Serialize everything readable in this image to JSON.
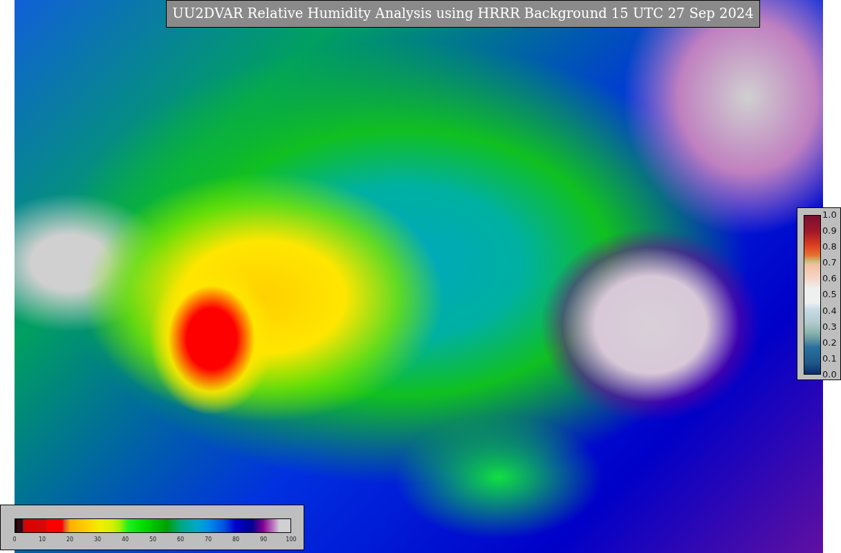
{
  "title": "UU2DVAR Relative Humidity Analysis using HRRR Background 15 UTC 27 Sep 2024",
  "colorbars": [
    {
      "kind": "horizontal",
      "tick_labels": [
        "0",
        "10",
        "20",
        "30",
        "40",
        "50",
        "60",
        "70",
        "80",
        "90",
        "100"
      ]
    },
    {
      "kind": "vertical",
      "tick_labels": [
        "1.0",
        "0.9",
        "0.8",
        "0.7",
        "0.6",
        "0.5",
        "0.4",
        "0.3",
        "0.2",
        "0.1",
        "0.0"
      ]
    }
  ]
}
